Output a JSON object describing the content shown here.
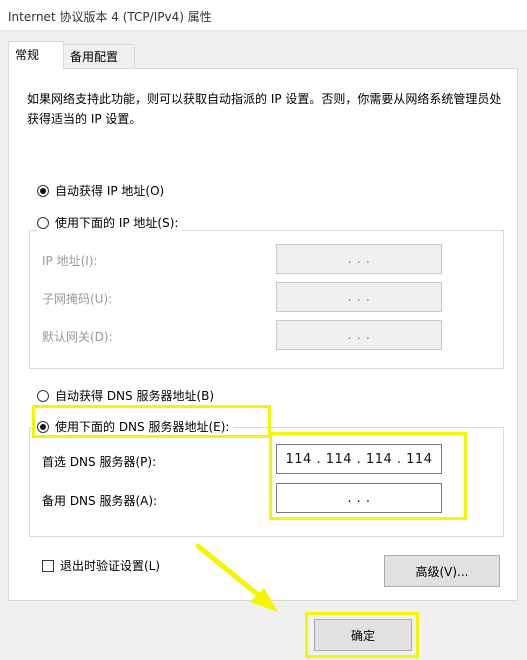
{
  "window": {
    "title": "Internet 协议版本 4 (TCP/IPv4) 属性"
  },
  "tabs": [
    {
      "label": "常规",
      "active": true
    },
    {
      "label": "备用配置",
      "active": false
    }
  ],
  "general": {
    "description": "如果网络支持此功能，则可以获取自动指派的 IP 设置。否则，你需要从网络系统管理员处获得适当的 IP 设置。",
    "ip": {
      "auto_label": "自动获得 IP 地址(O)",
      "manual_label": "使用下面的 IP 地址(S):",
      "auto_selected": true,
      "fields": [
        {
          "label": "IP 地址(I):",
          "value": ".     .     ."
        },
        {
          "label": "子网掩码(U):",
          "value": ".     .     ."
        },
        {
          "label": "默认网关(D):",
          "value": ".     .     ."
        }
      ]
    },
    "dns": {
      "auto_label": "自动获得 DNS 服务器地址(B)",
      "manual_label": "使用下面的 DNS 服务器地址(E):",
      "manual_selected": true,
      "preferred": {
        "label": "首选 DNS 服务器(P):",
        "value": "114 . 114 . 114 . 114"
      },
      "alternate": {
        "label": "备用 DNS 服务器(A):",
        "value": ".     .     ."
      }
    },
    "validate_label": "退出时验证设置(L)",
    "validate_checked": false,
    "advanced_label": "高级(V)..."
  },
  "footer": {
    "ok_label": "确定"
  },
  "colors": {
    "highlight": "#f5f500"
  }
}
